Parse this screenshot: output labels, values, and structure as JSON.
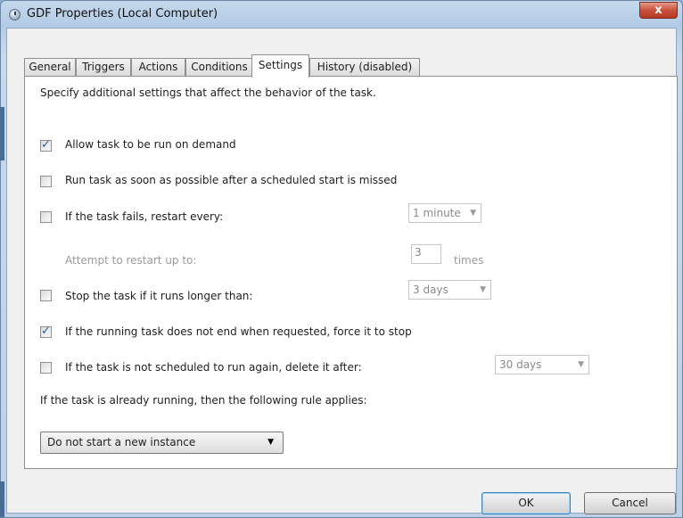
{
  "window": {
    "title": "GDF Properties (Local Computer)",
    "close_label": "x"
  },
  "tabs": [
    {
      "label": "General"
    },
    {
      "label": "Triggers"
    },
    {
      "label": "Actions"
    },
    {
      "label": "Conditions"
    },
    {
      "label": "Settings",
      "active": true
    },
    {
      "label": "History (disabled)"
    }
  ],
  "settings": {
    "intro": "Specify additional settings that affect the behavior of the task.",
    "allow_on_demand": {
      "label": "Allow task to be run on demand",
      "checked": true
    },
    "run_asap": {
      "label": "Run task as soon as possible after a scheduled start is missed",
      "checked": false
    },
    "restart_on_fail": {
      "label": "If the task fails, restart every:",
      "checked": false,
      "interval": "1 minute"
    },
    "attempt_restart": {
      "label": "Attempt to restart up to:",
      "value": "3",
      "unit": "times"
    },
    "stop_if_longer": {
      "label": "Stop the task if it runs longer than:",
      "checked": false,
      "duration": "3 days"
    },
    "force_stop": {
      "label": "If the running task does not end when requested, force it to stop",
      "checked": true
    },
    "delete_if_not_scheduled": {
      "label": "If the task is not scheduled to run again, delete it after:",
      "checked": false,
      "duration": "30 days"
    },
    "rule_label": "If the task is already running, then the following rule applies:",
    "rule_value": "Do not start a new instance"
  },
  "buttons": {
    "ok": "OK",
    "cancel": "Cancel"
  }
}
